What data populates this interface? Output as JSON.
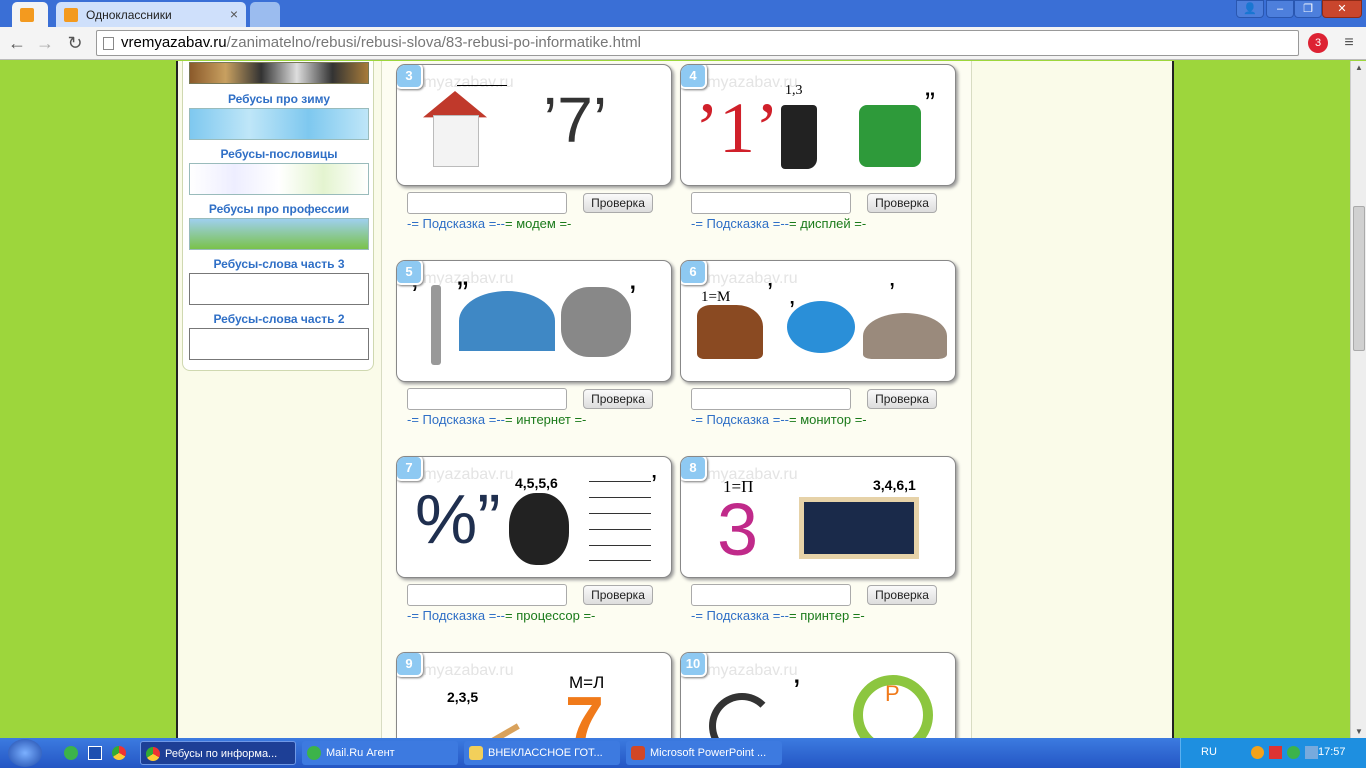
{
  "browser": {
    "tabs": [
      {
        "title": ""
      },
      {
        "title": "Одноклассники"
      }
    ],
    "url_host": "vremyazabav.ru",
    "url_path": "/zanimatelno/rebusi/rebusi-slova/83-rebusi-po-informatike.html",
    "extension_badge": "3"
  },
  "sidebar": {
    "items": [
      {
        "label": "Ребусы про зиму"
      },
      {
        "label": "Ребусы-пословицы"
      },
      {
        "label": "Ребусы про профессии"
      },
      {
        "label": "Ребусы-слова часть 3"
      },
      {
        "label": "Ребусы-слова часть 2"
      }
    ]
  },
  "watermark": "vremyazabav.ru",
  "check_label": "Проверка",
  "hint_prefix": "-= Подсказка =--",
  "puzzles": [
    {
      "number": "3",
      "hint": "= модем =-",
      "labels": [
        "’7’"
      ]
    },
    {
      "number": "4",
      "hint": "= дисплей =-",
      "labels": [
        "’1’",
        "1,3",
        "”"
      ]
    },
    {
      "number": "5",
      "hint": "= интернет =-",
      "labels": [
        "’",
        "”",
        "’"
      ]
    },
    {
      "number": "6",
      "hint": "= монитор =-",
      "labels": [
        "1=М",
        "’",
        "’",
        "’"
      ]
    },
    {
      "number": "7",
      "hint": "= процессор =-",
      "labels": [
        "%”",
        "4,5,5,6",
        "’"
      ]
    },
    {
      "number": "8",
      "hint": "= принтер =-",
      "labels": [
        "1=П",
        "3",
        "3,4,6,1"
      ]
    },
    {
      "number": "9",
      "hint": "",
      "labels": [
        "2,3,5",
        "М=Л",
        "7"
      ]
    },
    {
      "number": "10",
      "hint": "",
      "labels": [
        "’",
        "Р"
      ]
    }
  ],
  "taskbar": {
    "items": [
      {
        "label": "Ребусы по информа..."
      },
      {
        "label": "Mail.Ru Агент"
      },
      {
        "label": "ВНЕКЛАССНОЕ ГОТ..."
      },
      {
        "label": "Microsoft PowerPoint ..."
      }
    ],
    "lang": "RU",
    "clock": "17:57"
  },
  "colors": {
    "page_bg": "#9dd63c",
    "link": "#2f6fc6",
    "hint_green": "#1a7a1a",
    "badge": "#8ec9f2"
  }
}
